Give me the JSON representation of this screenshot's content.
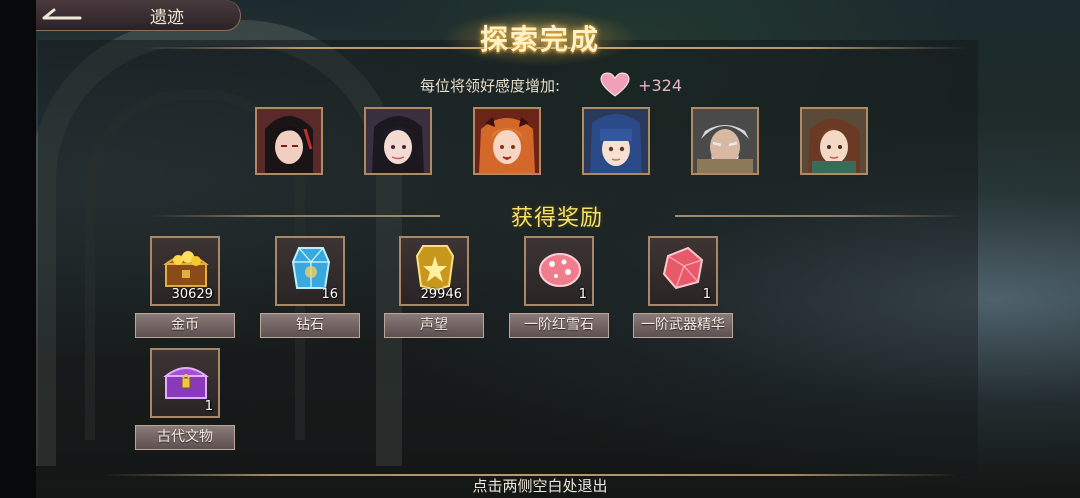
{
  "header": {
    "back_title": "遗迹",
    "title": "探索完成"
  },
  "favor": {
    "label": "每位将领好感度增加:",
    "value": "+324",
    "icon": "heart-icon",
    "icon_color": "#f2a0b8"
  },
  "portraits": [
    {
      "name": "portrait-1"
    },
    {
      "name": "portrait-2"
    },
    {
      "name": "portrait-3"
    },
    {
      "name": "portrait-4"
    },
    {
      "name": "portrait-5"
    },
    {
      "name": "portrait-6"
    }
  ],
  "rewards_section": {
    "title": "获得奖励"
  },
  "rewards": [
    {
      "label": "金币",
      "count": "30629",
      "icon": "treasure-chest-icon"
    },
    {
      "label": "钻石",
      "count": "16",
      "icon": "diamond-crystal-icon"
    },
    {
      "label": "声望",
      "count": "29946",
      "icon": "prestige-badge-icon"
    },
    {
      "label": "一阶红雪石",
      "count": "1",
      "icon": "red-snow-stone-icon"
    },
    {
      "label": "一阶武器精华",
      "count": "1",
      "icon": "weapon-essence-icon"
    },
    {
      "label": "古代文物",
      "count": "1",
      "icon": "ancient-relic-chest-icon"
    }
  ],
  "footer": {
    "hint": "点击两侧空白处退出"
  },
  "colors": {
    "accent_gold": "#f5e26a",
    "frame_border": "#b08a62"
  }
}
